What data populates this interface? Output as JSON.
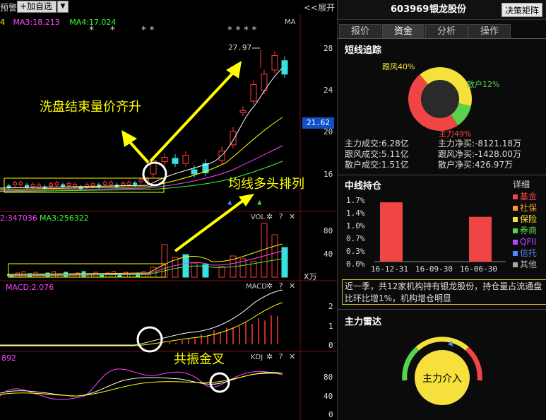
{
  "toolbar": {
    "partial_label": "预警",
    "add_fav_label": "+加自选",
    "dropdown_glyph": "▼",
    "expand_label": "<<展开"
  },
  "main_chart": {
    "ma_labels": [
      {
        "text": "4",
        "color": "#ffff00"
      },
      {
        "text": "MA3:18.213",
        "color": "#ff44ff"
      },
      {
        "text": "MA4:17.024",
        "color": "#33ff33"
      }
    ],
    "ma_tag": "MA",
    "price_ticks": [
      "28",
      "24",
      "20",
      "16"
    ],
    "current_price": "21.62",
    "high_price_label": "27.97",
    "stars": [
      "*",
      "*",
      "* *",
      "* * * *"
    ],
    "annotations": {
      "washout": "洗盘结束量价齐升",
      "ma_bull": "均线多头排列"
    }
  },
  "vol_panel": {
    "label_left": "2:347036",
    "label_ma3": "MA3:256322",
    "tag": "VOL",
    "ticks": [
      "80",
      "40"
    ],
    "unit": "X万"
  },
  "macd_panel": {
    "label": "MACD:2.076",
    "tag": "MACD",
    "ticks": [
      "2",
      "1",
      "0"
    ],
    "annotation": "共振金叉"
  },
  "kdj_panel": {
    "label": "892",
    "tag": "KDJ",
    "ticks": [
      "80",
      "40",
      "0"
    ]
  },
  "panel_icons": {
    "gear": "✲",
    "help": "?",
    "close": "✕"
  },
  "header": {
    "code": "603969",
    "name": "银龙股份",
    "matrix_button": "决策矩阵"
  },
  "tabs": [
    "报价",
    "资金",
    "分析",
    "操作"
  ],
  "active_tab": "资金",
  "short_track": {
    "title": "短线追踪",
    "donut": [
      {
        "label": "跟风40%",
        "color": "#f5e03c",
        "percent": 40
      },
      {
        "label": "散户12%",
        "color": "#5ad24a",
        "percent": 12
      },
      {
        "label": "主力49%",
        "color": "#f04545",
        "percent": 49
      }
    ],
    "stats": [
      [
        "主力成交:6.28亿",
        "主力净买:-8121.18万"
      ],
      [
        "跟风成交:5.11亿",
        "跟风净买:-1428.00万"
      ],
      [
        "散户成交:1.51亿",
        "散户净买:426.97万"
      ]
    ]
  },
  "holding": {
    "title": "中线持仓",
    "detail_link": "详细",
    "y_ticks": [
      "1.7%",
      "1.4%",
      "1.0%",
      "0.7%",
      "0.3%",
      "0.0%"
    ],
    "chart_data": {
      "type": "bar",
      "categories": [
        "16-12-31",
        "16-09-30",
        "16-06-30"
      ],
      "values": [
        1.55,
        0,
        1.17
      ],
      "ylim": [
        0,
        1.7
      ],
      "color": "#f04545"
    },
    "legend": [
      {
        "label": "基金",
        "color": "#f04545"
      },
      {
        "label": "社保",
        "color": "#ff9a2e"
      },
      {
        "label": "保险",
        "color": "#f5e03c"
      },
      {
        "label": "券商",
        "color": "#5ad24a"
      },
      {
        "label": "QFII",
        "color": "#c040ff"
      },
      {
        "label": "信托",
        "color": "#4f8bff"
      },
      {
        "label": "其他",
        "color": "#aaaaaa"
      }
    ],
    "note": "近一季，共12家机构持有银龙股份，持仓量占流通盘比环比增1%，机构增仓明显"
  },
  "radar": {
    "title": "主力雷达",
    "center_label": "主力介入"
  }
}
